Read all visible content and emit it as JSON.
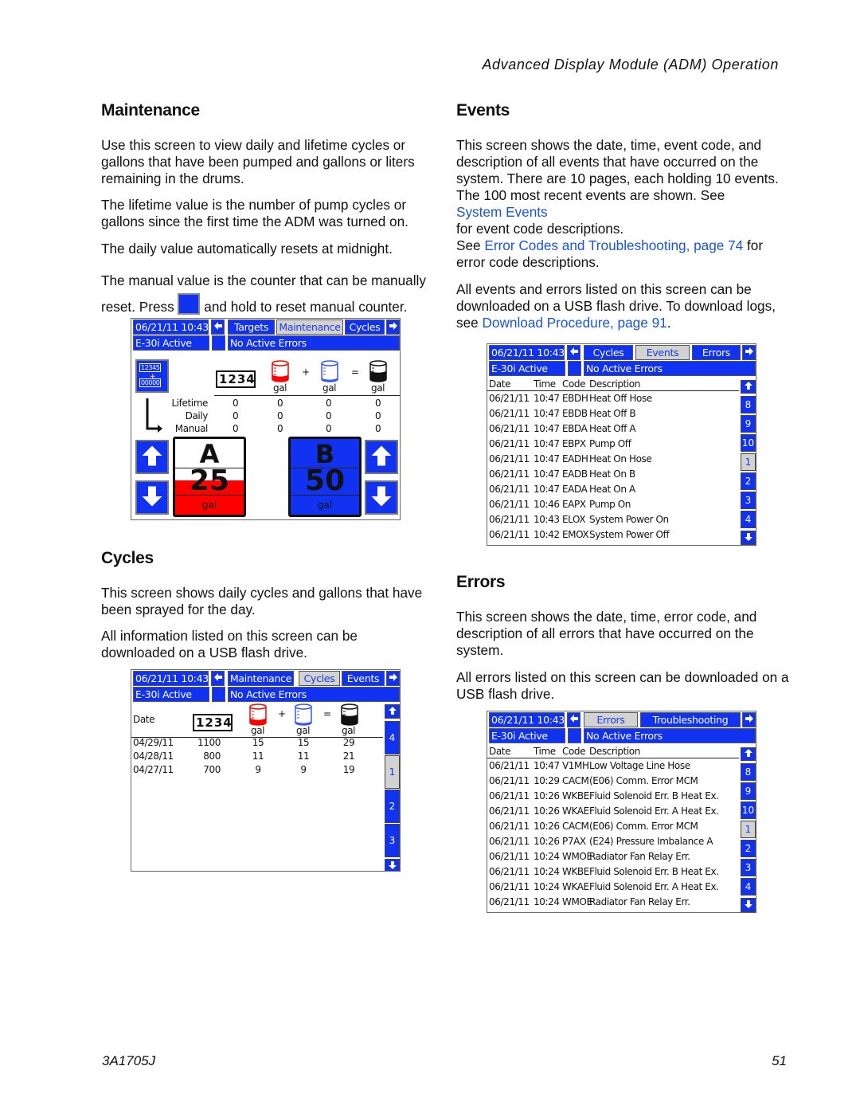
{
  "running_header": "Advanced Display Module (ADM) Operation",
  "footer": {
    "doc_number": "3A1705J",
    "page_number": "51"
  },
  "colors": {
    "screen_blue": "#1232f2",
    "link": "#1a55d6",
    "component_a": "#ff0000",
    "component_b": "#1232f2"
  },
  "maintenance": {
    "heading": "Maintenance",
    "p1": "Use this screen to view daily and lifetime cycles or gallons that have been pumped and gallons or liters remaining in the drums.",
    "p2": "The lifetime value is the number of pump cycles or gallons since the first time the ADM was turned on.",
    "p3": "The daily value automatically resets at midnight.",
    "p4a": "The manual value is the counter that can be manually reset. Press",
    "p4b": "and hold to reset manual counter."
  },
  "cycles": {
    "heading": "Cycles",
    "p1": "This screen shows daily cycles and gallons that have been sprayed for the day.",
    "p2": "All information listed on this screen can be downloaded on a USB flash drive."
  },
  "events": {
    "heading": "Events",
    "p1a": "This screen shows the date, time, event code, and description of all events that have occurred on the system.  There are 10 pages, each holding 10 events. The 100 most recent events are shown. See",
    "link1": "System Events",
    "p1b": "for event code descriptions.",
    "p1c": "See",
    "link2": "Error Codes and Troubleshooting, page 74",
    "p1d": "for error code descriptions.",
    "p2a": "All events and errors listed on this screen can be downloaded on a USB flash drive. To download logs, see",
    "link3": "Download Procedure, page 91",
    "p2b": "."
  },
  "errors": {
    "heading": "Errors",
    "p1": "This screen shows the date, time, error code, and description of all errors that have occurred on the system.",
    "p2": "All errors listed on this screen can be downloaded on a USB flash drive."
  },
  "screens": {
    "maintenance": {
      "datetime": "06/21/11 10:43",
      "tabs": [
        "Targets",
        "Maintenance",
        "Cycles"
      ],
      "selected_tab": 1,
      "status": "E-30i Active",
      "errors": "No Active Errors",
      "reset_icon": {
        "top": "12345",
        "bottom": "00000"
      },
      "counter_icon": "1234",
      "unit": "gal",
      "plus": "+",
      "equals": "=",
      "rows": [
        {
          "label": "Lifetime",
          "values": [
            "0",
            "0",
            "0",
            "0"
          ]
        },
        {
          "label": "Daily",
          "values": [
            "0",
            "0",
            "0",
            "0"
          ]
        },
        {
          "label": "Manual",
          "values": [
            "0",
            "0",
            "0",
            "0"
          ]
        }
      ],
      "panel_a": {
        "letter": "A",
        "value": "25",
        "unit": "gal"
      },
      "panel_b": {
        "letter": "B",
        "value": "50",
        "unit": "gal"
      }
    },
    "cycles": {
      "datetime": "06/21/11 10:43",
      "tabs": [
        "Maintenance",
        "Cycles",
        "Events"
      ],
      "selected_tab": 1,
      "status": "E-30i Active",
      "errors": "No Active Errors",
      "date_label": "Date",
      "counter_icon": "1234",
      "unit": "gal",
      "plus": "+",
      "equals": "=",
      "rows": [
        [
          "04/29/11",
          "1100",
          "15",
          "15",
          "29"
        ],
        [
          "04/28/11",
          "800",
          "11",
          "11",
          "21"
        ],
        [
          "04/27/11",
          "700",
          "9",
          "9",
          "19"
        ]
      ],
      "pages": [
        "4",
        "1",
        "2",
        "3"
      ],
      "selected_page": "1"
    },
    "events": {
      "datetime": "06/21/11 10:43",
      "tabs": [
        "Cycles",
        "Events",
        "Errors"
      ],
      "selected_tab": 1,
      "status": "E-30i Active",
      "errors": "No Active Errors",
      "columns": [
        "Date",
        "Time",
        "Code",
        "Description"
      ],
      "rows": [
        [
          "06/21/11",
          "10:47",
          "EBDH",
          "Heat Off Hose"
        ],
        [
          "06/21/11",
          "10:47",
          "EBDB",
          "Heat Off B"
        ],
        [
          "06/21/11",
          "10:47",
          "EBDA",
          "Heat Off A"
        ],
        [
          "06/21/11",
          "10:47",
          "EBPX",
          "Pump Off"
        ],
        [
          "06/21/11",
          "10:47",
          "EADH",
          "Heat On Hose"
        ],
        [
          "06/21/11",
          "10:47",
          "EADB",
          "Heat On B"
        ],
        [
          "06/21/11",
          "10:47",
          "EADA",
          "Heat On A"
        ],
        [
          "06/21/11",
          "10:46",
          "EAPX",
          "Pump On"
        ],
        [
          "06/21/11",
          "10:43",
          "ELOX",
          "System Power On"
        ],
        [
          "06/21/11",
          "10:42",
          "EMOX",
          "System Power Off"
        ]
      ],
      "pages": [
        "8",
        "9",
        "10",
        "1",
        "2",
        "3",
        "4"
      ],
      "selected_page": "1"
    },
    "errors": {
      "datetime": "06/21/11 10:43",
      "tabs": [
        "Errors",
        "Troubleshooting"
      ],
      "selected_tab": 0,
      "status": "E-30i Active",
      "errors": "No Active Errors",
      "columns": [
        "Date",
        "Time",
        "Code",
        "Description"
      ],
      "rows": [
        [
          "06/21/11",
          "10:47",
          "V1MH",
          "Low Voltage Line Hose"
        ],
        [
          "06/21/11",
          "10:29",
          "CACM",
          "(E06) Comm. Error MCM"
        ],
        [
          "06/21/11",
          "10:26",
          "WKBE",
          "Fluid Solenoid Err. B Heat Ex."
        ],
        [
          "06/21/11",
          "10:26",
          "WKAE",
          "Fluid Solenoid Err. A Heat Ex."
        ],
        [
          "06/21/11",
          "10:26",
          "CACM",
          "(E06) Comm. Error MCM"
        ],
        [
          "06/21/11",
          "10:26",
          "P7AX",
          "(E24) Pressure Imbalance A"
        ],
        [
          "06/21/11",
          "10:24",
          "WMOE",
          "Radiator Fan Relay Err."
        ],
        [
          "06/21/11",
          "10:24",
          "WKBE",
          "Fluid Solenoid Err. B Heat Ex."
        ],
        [
          "06/21/11",
          "10:24",
          "WKAE",
          "Fluid Solenoid Err. A Heat Ex."
        ],
        [
          "06/21/11",
          "10:24",
          "WMOE",
          "Radiator Fan Relay Err."
        ]
      ],
      "pages": [
        "8",
        "9",
        "10",
        "1",
        "2",
        "3",
        "4"
      ],
      "selected_page": "1"
    }
  }
}
